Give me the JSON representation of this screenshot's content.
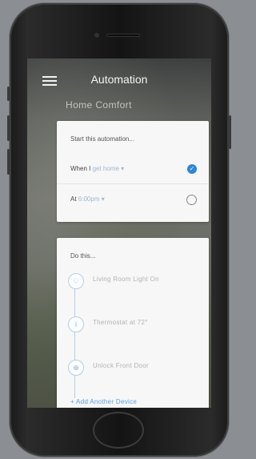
{
  "header": {
    "title": "Automation"
  },
  "automation": {
    "name": "Home Comfort"
  },
  "trigger": {
    "heading": "Start this automation...",
    "options": [
      {
        "prefix": "When I",
        "value": "get home",
        "selected": true
      },
      {
        "prefix": "At",
        "value": "6:00pm",
        "selected": false
      }
    ]
  },
  "actions": {
    "heading": "Do this...",
    "devices": [
      {
        "label": "Living Room Light On",
        "icon": "lightbulb-icon"
      },
      {
        "label": "Thermostat at 72°",
        "icon": "thermostat-icon"
      },
      {
        "label": "Unlock Front Door",
        "icon": "lock-icon"
      }
    ],
    "add_label": "+ Add Another Device"
  },
  "colors": {
    "accent": "#2d86d6",
    "link": "#5ba0e3"
  }
}
